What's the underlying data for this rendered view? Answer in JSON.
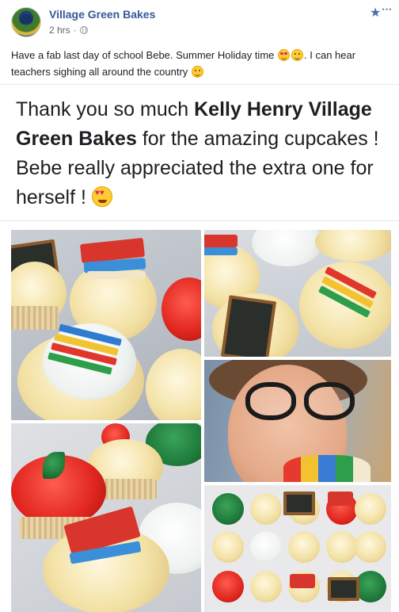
{
  "post": {
    "page_name": "Village Green Bakes",
    "timestamp": "2 hrs",
    "privacy_icon": "globe-icon",
    "text": "Have a fab last day of school Bebe. Summer Holiday time",
    "text_after_emoji": ". I can hear teachers sighing all around the country",
    "emojis": [
      "smiling-face-with-hearts",
      "smiling-face",
      "grinning-face"
    ]
  },
  "shared_post": {
    "text_before": "Thank you so much ",
    "bold_names": "Kelly Henry Village Green Bakes",
    "text_after": " for the amazing cupcakes ! Bebe really appreciated the extra one for herself !",
    "emoji": "heart-eyes"
  },
  "photos": {
    "count": 5,
    "descriptions_icons": [
      "cupcakes-crayons-books",
      "cupcakes-chalkboard",
      "cupcakes-apples-books",
      "girl-eating-cupcake",
      "cupcake-box"
    ]
  },
  "colors": {
    "brand_blue": "#365899",
    "meta_gray": "#616770",
    "text": "#1c1e21"
  }
}
